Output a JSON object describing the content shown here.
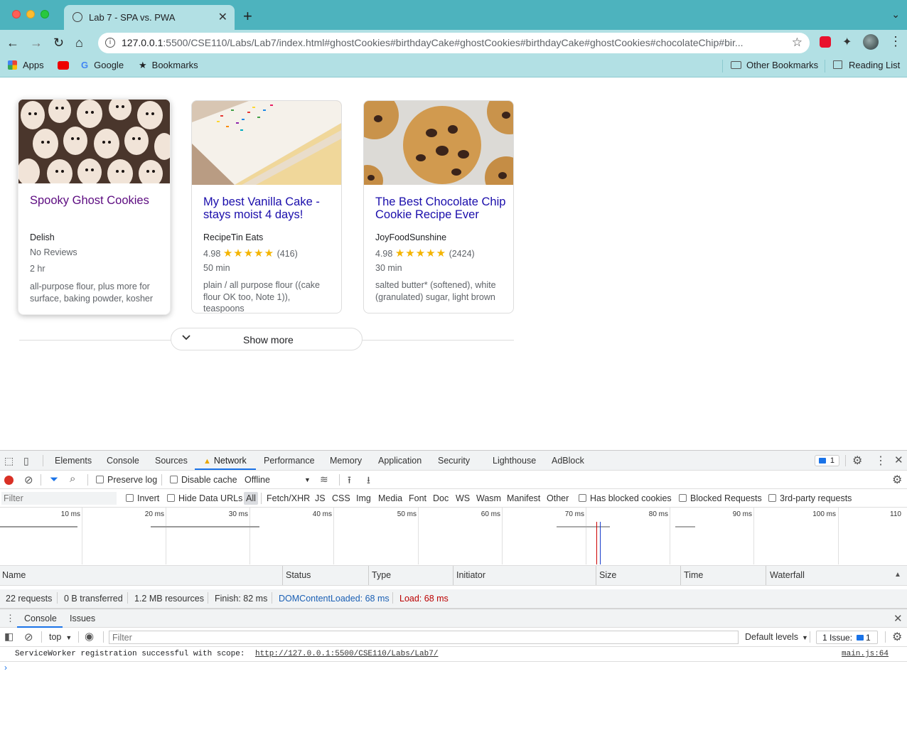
{
  "browser": {
    "tab_title": "Lab 7 - SPA vs. PWA",
    "url_host": "127.0.0.1",
    "url_rest": ":5500/CSE110/Labs/Lab7/index.html#ghostCookies#birthdayCake#ghostCookies#birthdayCake#ghostCookies#chocolateChip#bir...",
    "bookmarks": {
      "apps": "Apps",
      "google": "Google",
      "bookmarks": "Bookmarks",
      "other": "Other Bookmarks",
      "reading": "Reading List"
    },
    "colors": {
      "titlebar": "#4db3be",
      "toolbar": "#b2e0e4"
    }
  },
  "page": {
    "cards": [
      {
        "title": "Spooky Ghost Cookies",
        "org": "Delish",
        "rating": "No Reviews",
        "time": "2 hr",
        "ingredients": "all-purpose flour, plus more for surface, baking powder, kosher"
      },
      {
        "title": "My best Vanilla Cake - stays moist 4 days!",
        "org": "RecipeTin Eats",
        "rating_value": "4.98",
        "stars": 5,
        "rating_count": "(416)",
        "time": "50 min",
        "ingredients": "plain / all purpose flour ((cake flour OK too, Note 1)), teaspoons"
      },
      {
        "title": "The Best Chocolate Chip Cookie Recipe Ever",
        "org": "JoyFoodSunshine",
        "rating_value": "4.98",
        "stars": 5,
        "rating_count": "(2424)",
        "time": "30 min",
        "ingredients": "salted butter* (softened), white (granulated) sugar, light brown"
      }
    ],
    "show_more": "Show more",
    "colors": {
      "link": "#1a0dab",
      "visited": "#5c0b80",
      "star": "#f4b400"
    }
  },
  "devtools": {
    "tabs": [
      "Elements",
      "Console",
      "Sources",
      "Network",
      "Performance",
      "Memory",
      "Application",
      "Security",
      "Lighthouse",
      "AdBlock"
    ],
    "active_tab": "Network",
    "issues_badge": "1",
    "network_toolbar": {
      "preserve_log": "Preserve log",
      "disable_cache": "Disable cache",
      "throttle": "Offline"
    },
    "filter_bar": {
      "placeholder": "Filter",
      "invert": "Invert",
      "hide_data_urls": "Hide Data URLs",
      "types": [
        "All",
        "Fetch/XHR",
        "JS",
        "CSS",
        "Img",
        "Media",
        "Font",
        "Doc",
        "WS",
        "Wasm",
        "Manifest",
        "Other"
      ],
      "has_blocked": "Has blocked cookies",
      "blocked_requests": "Blocked Requests",
      "third_party": "3rd-party requests"
    },
    "timeline_ticks": [
      "10 ms",
      "20 ms",
      "30 ms",
      "40 ms",
      "50 ms",
      "60 ms",
      "70 ms",
      "80 ms",
      "90 ms",
      "100 ms",
      "110"
    ],
    "columns": [
      "Name",
      "Status",
      "Type",
      "Initiator",
      "Size",
      "Time",
      "Waterfall"
    ],
    "status_bar": {
      "requests": "22 requests",
      "transferred": "0 B transferred",
      "resources": "1.2 MB resources",
      "finish": "Finish: 82 ms",
      "dcl": "DOMContentLoaded: 68 ms",
      "load": "Load: 68 ms"
    },
    "drawer": {
      "tabs": [
        "Console",
        "Issues"
      ],
      "context": "top",
      "filter_placeholder": "Filter",
      "levels": "Default levels",
      "issues": "1 Issue:",
      "issues_count": "1",
      "message": "ServiceWorker registration successful with scope:",
      "message_link": "http://127.0.0.1:5500/CSE110/Labs/Lab7/",
      "source": "main.js:64"
    }
  }
}
